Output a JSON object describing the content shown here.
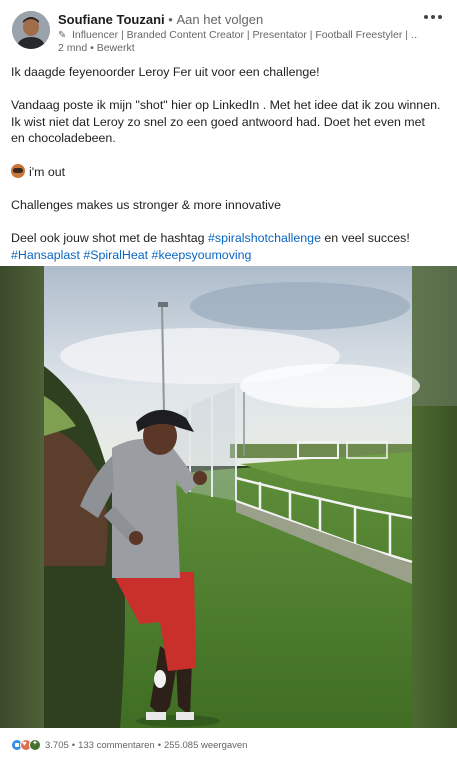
{
  "header": {
    "author_name": "Soufiane Touzani",
    "separator": "•",
    "follow_status": "Aan het volgen",
    "headline": "Influencer | Branded Content Creator | Presentator | Football Freestyler | ...",
    "timestamp": "2 mnd",
    "edited": "Bewerkt",
    "time_separator": "•"
  },
  "post": {
    "line1": "Ik daagde feyenoorder Leroy Fer uit voor een challenge!",
    "para2": "Vandaag poste ik mijn \"shot\" hier op LinkedIn . Met het idee dat ik zou winnen. Ik wist niet dat Leroy zo snel zo een goed antwoord had. Doet het even met en chocoladebeen.",
    "line3": "i'm out",
    "line4": "Challenges makes us stronger & more innovative",
    "line5_prefix": "Deel ook jouw shot met de hashtag ",
    "line5_hashtag": "#spiralshotchallenge",
    "line5_suffix": " en veel succes!",
    "hashtags": [
      "#Hansaplast",
      "#SpiralHeat",
      "#keepsyoumoving"
    ]
  },
  "video": {
    "icon": "video-player"
  },
  "footer": {
    "reactions": [
      "like-icon",
      "love-icon",
      "celebrate-icon"
    ],
    "reaction_count": "3.705",
    "comments": "133 commentaren",
    "views": "255.085 weergaven",
    "separator": "•"
  },
  "colors": {
    "link": "#0a66c2",
    "muted": "#666666",
    "like": "#378fe9",
    "love": "#df704d",
    "celebrate": "#44712e"
  }
}
